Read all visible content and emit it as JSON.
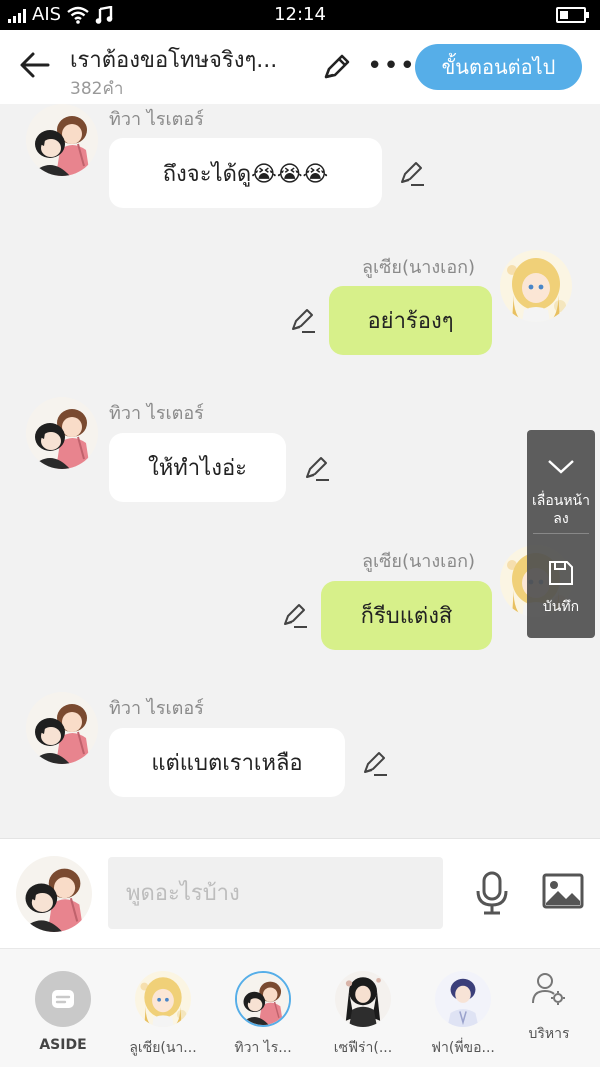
{
  "status_bar": {
    "carrier": "AIS",
    "time": "12:14"
  },
  "header": {
    "title": "เราต้องขอโทษจริงๆ...",
    "word_count": "382คำ",
    "next_button": "ขั้นตอนต่อไป"
  },
  "messages": [
    {
      "side": "left",
      "sender": "ทิวา ไรเตอร์",
      "text": "ถึงจะได้ดู😭😭😭"
    },
    {
      "side": "right",
      "sender": "ลูเซีย(นางเอก)",
      "text": "อย่าร้องๆ"
    },
    {
      "side": "left",
      "sender": "ทิวา ไรเตอร์",
      "text": "ให้ทำไงอ่ะ"
    },
    {
      "side": "right",
      "sender": "ลูเซีย(นางเอก)",
      "text": "ก็รีบแต่งสิ"
    },
    {
      "side": "left",
      "sender": "ทิวา ไรเตอร์",
      "text": "แต่แบตเราเหลือ"
    }
  ],
  "float_panel": {
    "scroll_down": "เลื่อนหน้าลง",
    "save": "บันทึก"
  },
  "input": {
    "placeholder": "พูดอะไรบ้าง"
  },
  "characters": [
    {
      "label": "ASIDE"
    },
    {
      "label": "ลูเซีย(นา..."
    },
    {
      "label": "ทิวา ไร..."
    },
    {
      "label": "เซฟีร่า(..."
    },
    {
      "label": "ฟา(พี่ขอ..."
    },
    {
      "label": "บริหาร"
    }
  ],
  "colors": {
    "accent": "#56aee8",
    "right_bubble": "#d7f08a",
    "left_bubble": "#ffffff",
    "background": "#f2f2f2"
  },
  "icons": [
    "back-arrow-icon",
    "pencil-icon",
    "more-icon",
    "chevron-down-icon",
    "save-icon",
    "microphone-icon",
    "image-icon",
    "manage-person-icon"
  ]
}
